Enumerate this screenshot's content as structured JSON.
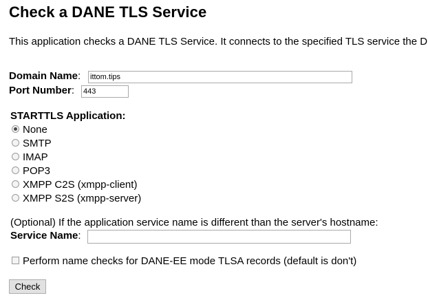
{
  "page": {
    "title": "Check a DANE TLS Service",
    "intro": "This application checks a DANE TLS Service. It connects to the specified TLS service the DNS."
  },
  "form": {
    "domain_label": "Domain Name",
    "domain_value": "ittom.tips",
    "port_label": "Port Number",
    "port_value": "443",
    "starttls_heading": "STARTTLS Application:",
    "starttls_options": [
      {
        "label": "None",
        "checked": true
      },
      {
        "label": "SMTP",
        "checked": false
      },
      {
        "label": "IMAP",
        "checked": false
      },
      {
        "label": "POP3",
        "checked": false
      },
      {
        "label": "XMPP C2S (xmpp-client)",
        "checked": false
      },
      {
        "label": "XMPP S2S (xmpp-server)",
        "checked": false
      }
    ],
    "optional_text": "(Optional) If the application service name is different than the server's hostname:",
    "service_label": "Service Name",
    "service_value": "",
    "name_check_label": "Perform name checks for DANE-EE mode TLSA records (default is don't)",
    "name_check_checked": false,
    "submit_label": "Check",
    "colon": ":"
  }
}
